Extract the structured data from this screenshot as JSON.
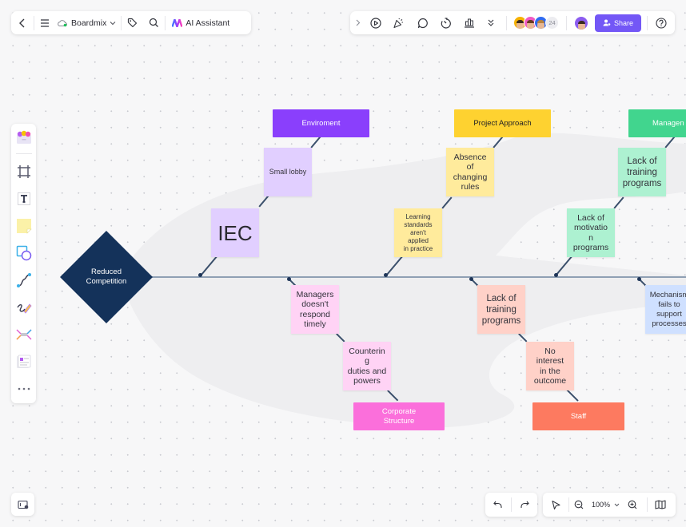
{
  "toolbar_left": {
    "back_icon": "chevron-left-icon",
    "menu_icon": "hamburger-menu-icon",
    "cloud_icon": "cloud-saved-icon",
    "board_name": "Boardmix",
    "board_dropdown_icon": "chevron-down-icon",
    "tag_icon": "tag-icon",
    "search_icon": "search-icon",
    "ai_icon": "ai-assistant-logo-icon",
    "ai_label": "AI Assistant"
  },
  "toolbar_right": {
    "collapse_icon": "chevron-right-icon",
    "icons": [
      "present-play-icon",
      "celebrate-icon",
      "comment-icon",
      "timer-icon",
      "vote-chart-icon",
      "more-chevrons-icon"
    ],
    "collaborators": [
      {
        "name": "collaborator-1",
        "ring": "#f6b100"
      },
      {
        "name": "collaborator-2",
        "ring": "#f05ac4"
      },
      {
        "name": "collaborator-3",
        "ring": "#2f6bf0"
      }
    ],
    "collaborator_count": "24",
    "share_label": "Share",
    "help_icon": "help-circle-icon"
  },
  "palette": {
    "items": [
      "templates-icon",
      "frame-icon",
      "text-icon",
      "sticky-note-icon",
      "shape-icon",
      "connector-icon",
      "pen-icon",
      "mindmap-icon",
      "page-card-icon",
      "more-icon"
    ]
  },
  "bottom": {
    "minimap_icon": "minimap-toggle-icon",
    "undo_icon": "undo-icon",
    "redo_icon": "redo-icon",
    "select_icon": "select-pointer-icon",
    "zoom_out_icon": "zoom-out-icon",
    "zoom_level": "100%",
    "zoom_in_icon": "zoom-in-icon",
    "map_icon": "map-icon"
  },
  "diagram": {
    "problem": "Reduced\nCompetition",
    "categories": [
      {
        "id": "enviroment",
        "label": "Enviroment",
        "color": "#8a3ffc",
        "text_color": "#ffffff"
      },
      {
        "id": "project-approach",
        "label": "Project Approach",
        "color": "#fed230",
        "text_color": "#1f1f25"
      },
      {
        "id": "management",
        "label": "Managen",
        "color": "#41d58e",
        "text_color": "#ffffff"
      },
      {
        "id": "corporate-structure",
        "label": "Corporate\nStructure",
        "color": "#fb6fdb",
        "text_color": "#ffffff"
      },
      {
        "id": "staff",
        "label": "Staff",
        "color": "#fd7a60",
        "text_color": "#ffffff"
      }
    ],
    "causes": [
      {
        "id": "small-lobby",
        "label": "Small lobby",
        "color": "#e1cfff"
      },
      {
        "id": "iec",
        "label": "IEC",
        "color": "#e1cfff"
      },
      {
        "id": "absence-changing-rules",
        "label": "Absence\nof\nchanging\nrules",
        "color": "#ffeb9c"
      },
      {
        "id": "learning-standards",
        "label": "Learning\nstandards\naren't\napplied\nin practice",
        "color": "#ffeb9c"
      },
      {
        "id": "lack-training-mgmt",
        "label": "Lack of\ntraining\nprograms",
        "color": "#adf1d1"
      },
      {
        "id": "lack-motivation",
        "label": "Lack of\nmotivatio\nn\nprograms",
        "color": "#adf1d1"
      },
      {
        "id": "managers-respond",
        "label": "Managers\ndoesn't\nrespond\ntimely",
        "color": "#ffd3f5"
      },
      {
        "id": "countering-duties",
        "label": "Counterin\ng\nduties and\npowers",
        "color": "#ffd3f5"
      },
      {
        "id": "lack-training-staff",
        "label": "Lack of\ntraining\nprograms",
        "color": "#ffd1c8"
      },
      {
        "id": "no-interest",
        "label": "No\ninterest\nin the\noutcome",
        "color": "#ffd1c8"
      },
      {
        "id": "mechanism-fails",
        "label": "Mechanism\nfails to\nsupport\nprocesses",
        "color": "#cfe0ff"
      }
    ]
  }
}
